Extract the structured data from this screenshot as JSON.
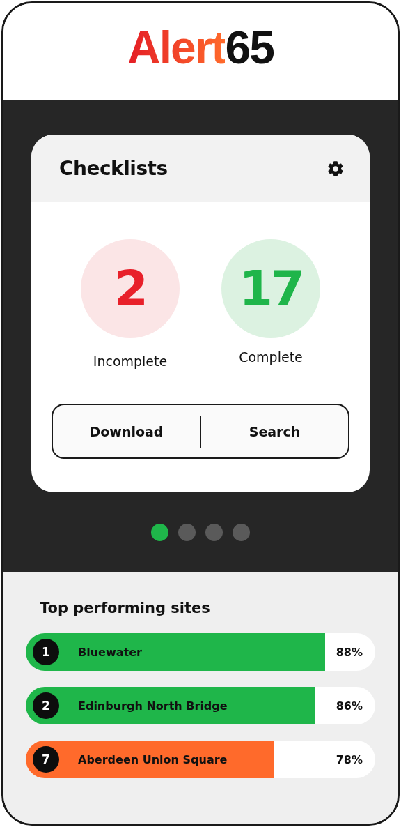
{
  "logo": {
    "brand": "Alert",
    "number": "65"
  },
  "card": {
    "title": "Checklists",
    "stats": [
      {
        "kind": "incomplete",
        "value": "2",
        "label": "Incomplete"
      },
      {
        "kind": "complete",
        "value": "17",
        "label": "Complete"
      }
    ],
    "actions": [
      "Download",
      "Search"
    ]
  },
  "pager": [
    {
      "selected": true
    },
    {
      "selected": false
    },
    {
      "selected": false
    },
    {
      "selected": false
    }
  ],
  "sites": {
    "title": "Top performing sites",
    "rows": [
      {
        "rank": "1",
        "name": "Bluewater",
        "percent": "88%",
        "level": 0.857,
        "color": "#1fb64a"
      },
      {
        "rank": "2",
        "name": "Edinburgh North Bridge",
        "percent": "86%",
        "level": 0.827,
        "color": "#1fb64a"
      },
      {
        "rank": "7",
        "name": "Aberdeen Union Square",
        "percent": "78%",
        "level": 0.71,
        "color": "#ff6a2b"
      }
    ]
  }
}
